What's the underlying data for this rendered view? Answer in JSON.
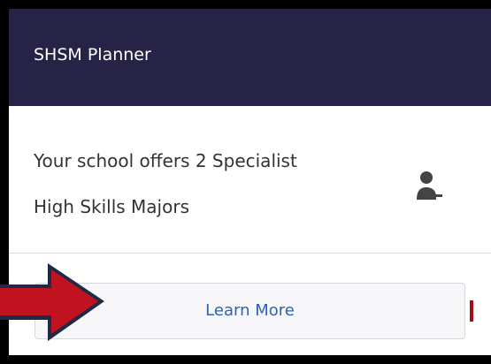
{
  "card": {
    "title": "SHSM Planner",
    "description_lines": [
      "Your school offers 2 Specialist",
      "High Skills Majors"
    ],
    "learn_more_label": "Learn More"
  },
  "icons": {
    "person": "person-icon",
    "arrow": "arrow-right-icon"
  },
  "colors": {
    "header": "#262346",
    "button_text": "#2b63b5",
    "arrow": "#c1121f"
  }
}
